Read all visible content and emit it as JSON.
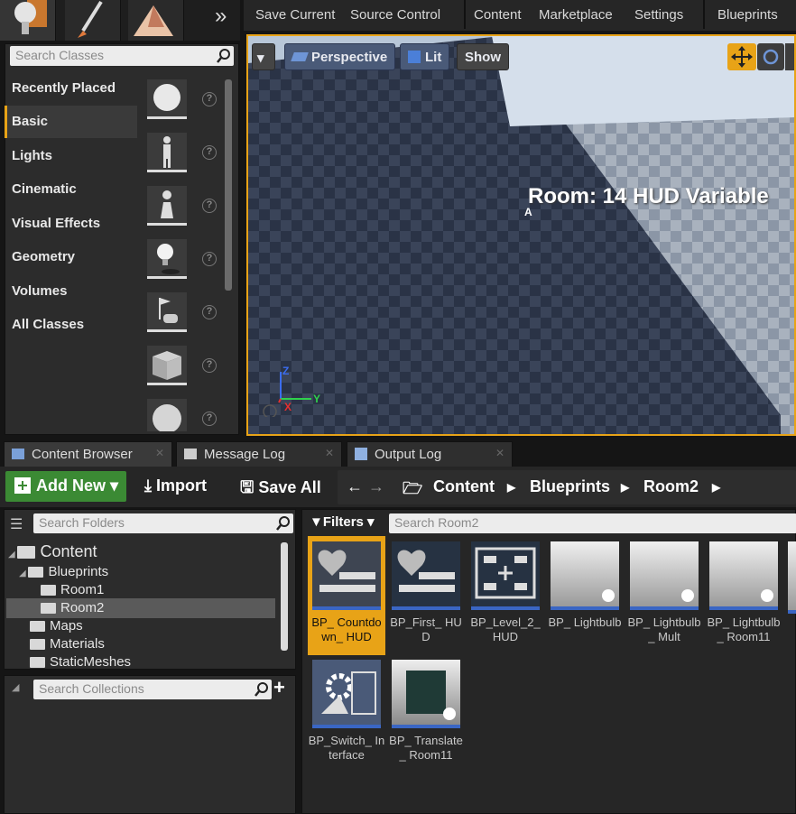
{
  "toolbar": {
    "save_current": "Save Current",
    "source_control": "Source Control",
    "content": "Content",
    "marketplace": "Marketplace",
    "settings": "Settings",
    "blueprints": "Blueprints"
  },
  "place": {
    "search_placeholder": "Search Classes",
    "categories": [
      "Recently Placed",
      "Basic",
      "Lights",
      "Cinematic",
      "Visual Effects",
      "Geometry",
      "Volumes",
      "All Classes"
    ],
    "selected": "Basic"
  },
  "viewport": {
    "menu": "▾",
    "perspective": "Perspective",
    "lit": "Lit",
    "show": "Show",
    "hud_text": "Room: 14 HUD Variable",
    "marker": "A",
    "axis_z": "Z",
    "axis_y": "Y",
    "axis_x": "X"
  },
  "tabs": [
    {
      "label": "Content Browser"
    },
    {
      "label": "Message Log"
    },
    {
      "label": "Output Log"
    }
  ],
  "cb": {
    "add_new": "Add New",
    "import": "Import",
    "save_all": "Save All",
    "crumbs": [
      "Content",
      "Blueprints",
      "Room2"
    ]
  },
  "folders": {
    "search_placeholder": "Search Folders",
    "tree": [
      "Content",
      "Blueprints",
      "Room1",
      "Room2",
      "Maps",
      "Materials",
      "StaticMeshes"
    ],
    "selected": "Room2"
  },
  "collections": {
    "search_placeholder": "Search Collections"
  },
  "assets": {
    "filters": "Filters",
    "search_placeholder": "Search Room2",
    "items": [
      "BP_ Countdown_ HUD",
      "BP_First_ HUD",
      "BP_Level_2_ HUD",
      "BP_ Lightbulb",
      "BP_ Lightbulb_ Mult",
      "BP_ Lightbulb_ Room11",
      "BP_Switch_ Interface",
      "BP_ Translate_ Room11"
    ],
    "selected": "BP_ Countdown_ HUD"
  },
  "colors": {
    "accent": "#e8a317",
    "add_new": "#3b8a34",
    "asset_underline": "#3a66c4"
  }
}
